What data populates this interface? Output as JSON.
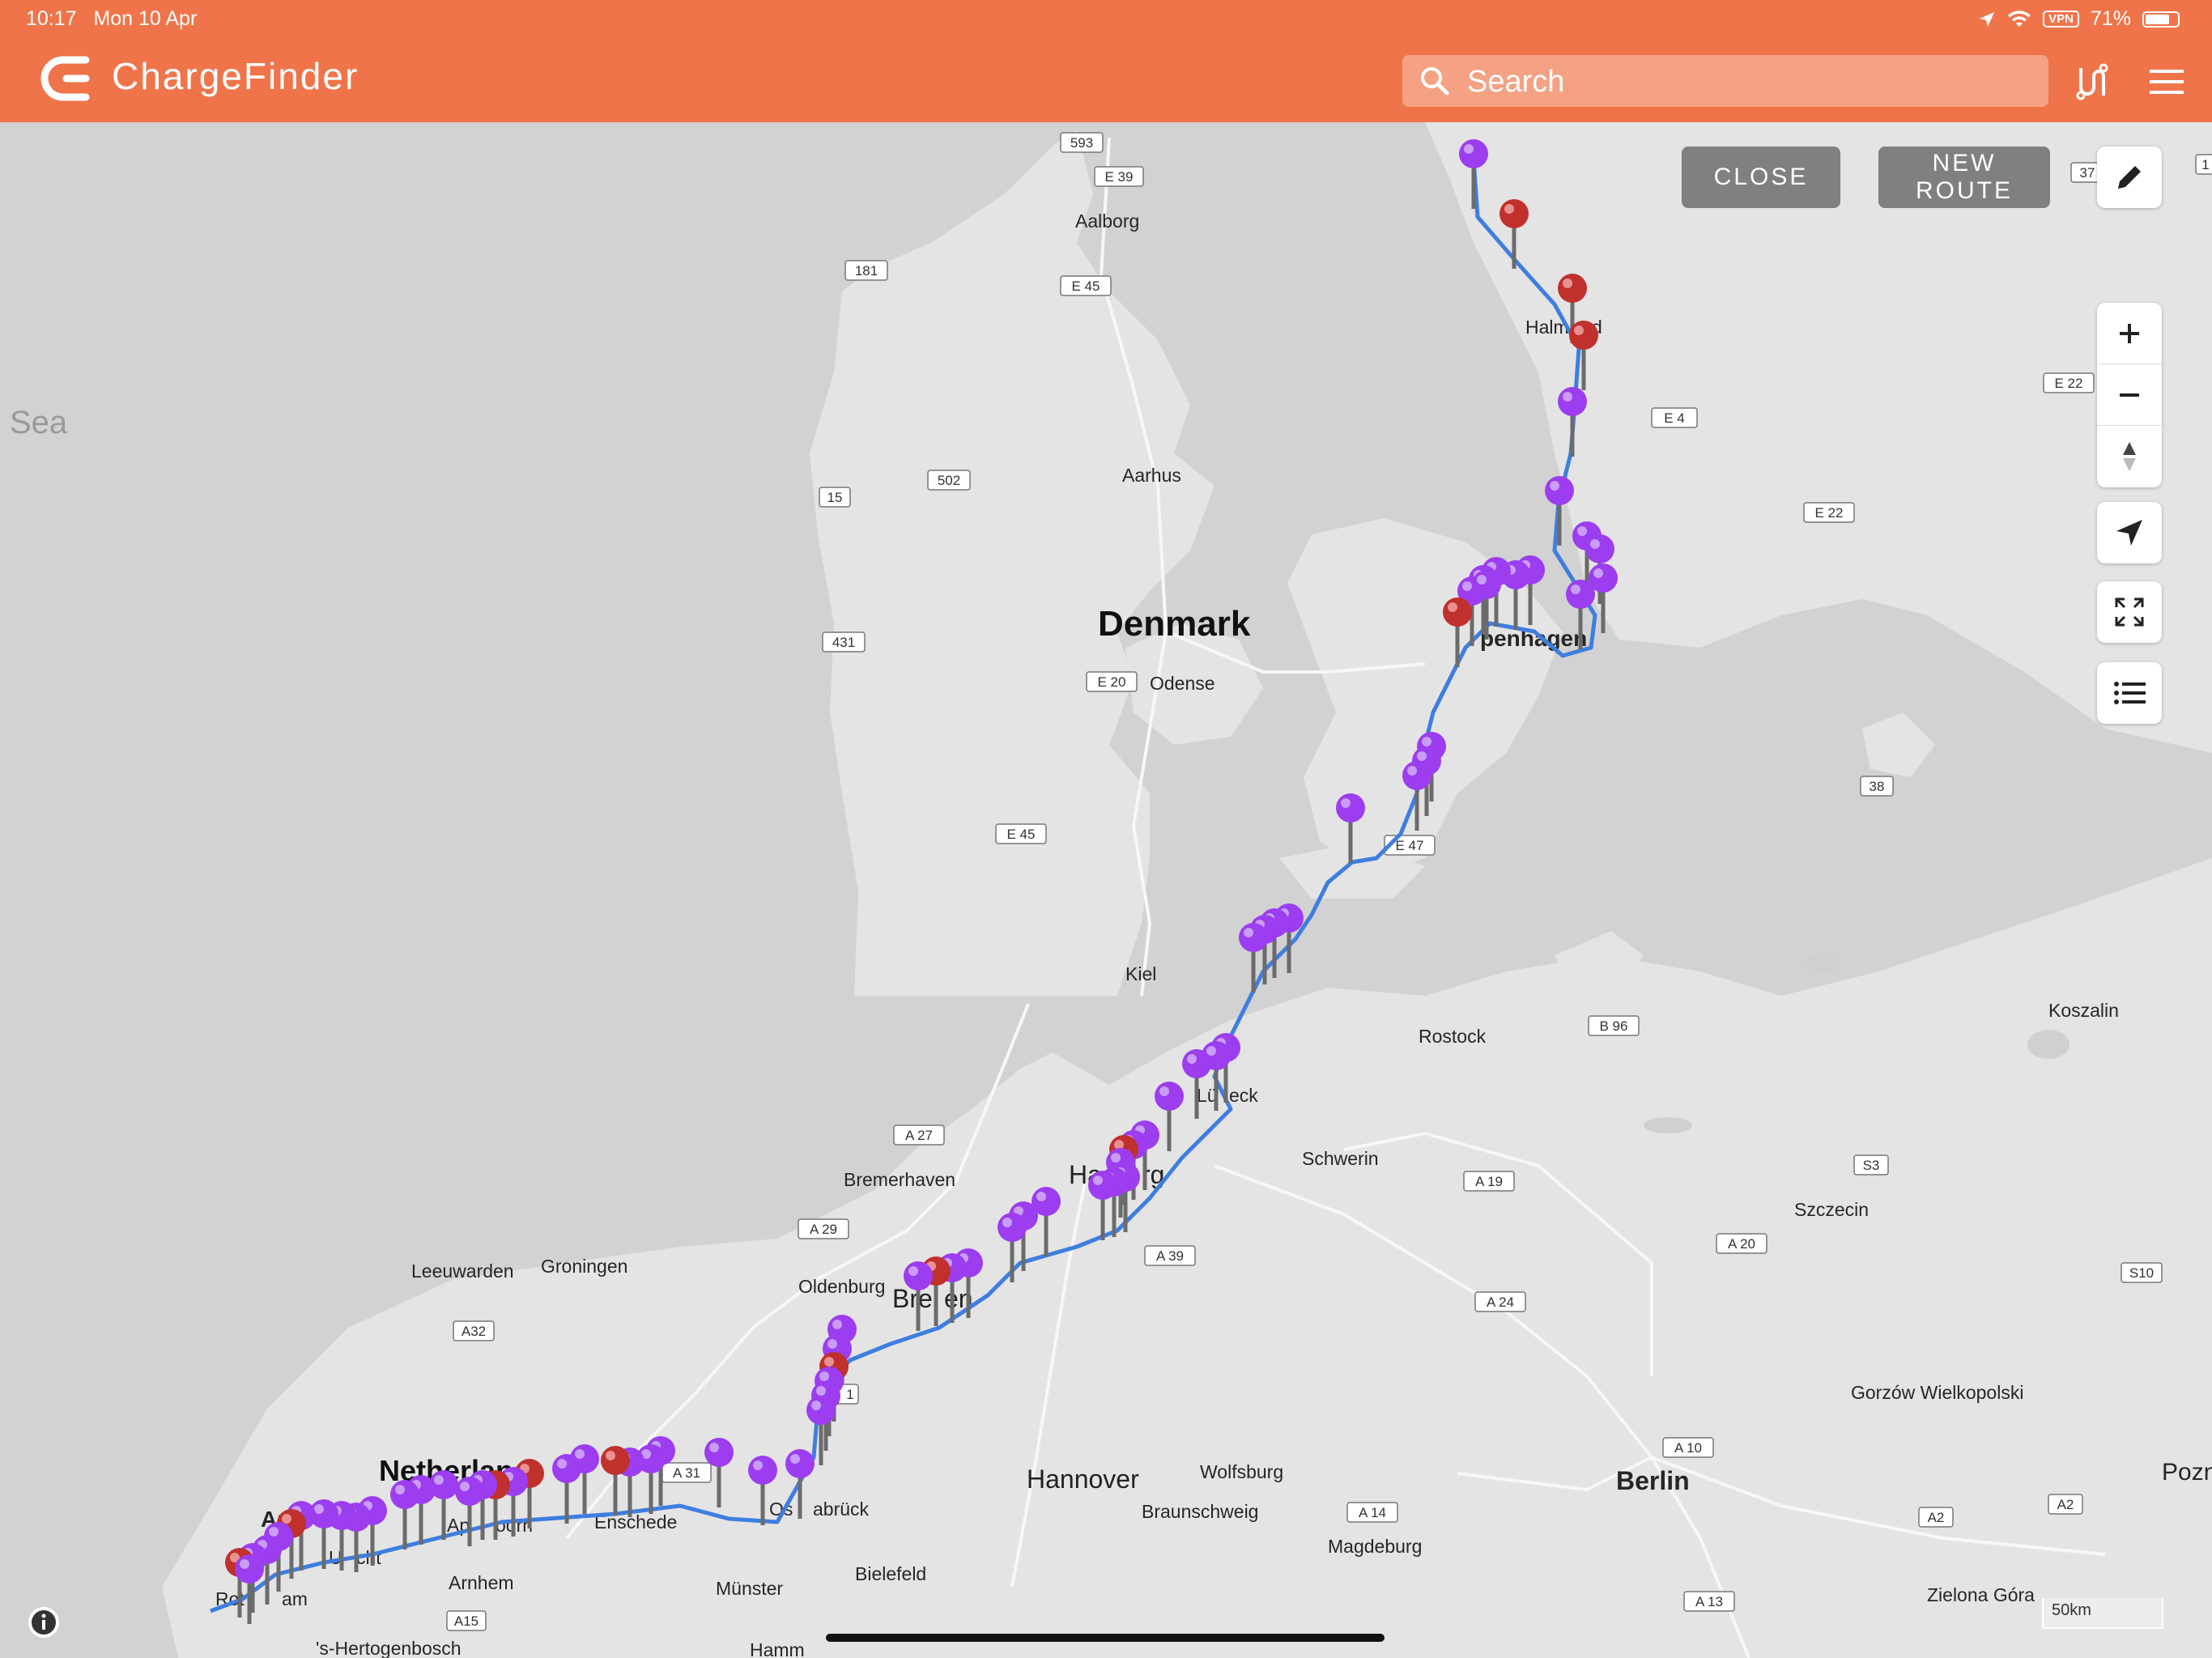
{
  "status_bar": {
    "time": "10:17",
    "date": "Mon 10 Apr",
    "vpn": "VPN",
    "battery": "71%"
  },
  "header": {
    "app_name": "ChargeFinder",
    "search_placeholder": "Search"
  },
  "route_controls": {
    "close_label": "CLOSE",
    "new_route_label": "NEW ROUTE"
  },
  "map": {
    "scale": "50km",
    "countries": {
      "denmark": "Denmark",
      "netherlands": "Netherland",
      "sea": "Sea"
    },
    "cities": {
      "aalborg": "Aalborg",
      "aarhus": "Aarhus",
      "odense": "Odense",
      "copenhagen": "penhagen",
      "halmstad": "Halm",
      "halmstad_end": "d",
      "kiel": "Kiel",
      "lubeck": "Lü",
      "lubeck_end": "eck",
      "rostock": "Rostock",
      "koszalin": "Koszalin",
      "schwerin": "Schwerin",
      "hamburg": "Ha",
      "hamburg_end": "rg",
      "bremerhaven": "Bremerhaven",
      "oldenburg": "Oldenburg",
      "bremen": "Bre",
      "bremen_end": "en",
      "szczecin": "Szczecin",
      "leeuwarden": "Leeuwarden",
      "groningen": "Groningen",
      "hannover": "Hannover",
      "wolfsburg": "Wolfsburg",
      "braunschweig": "Braunschweig",
      "berlin": "Berlin",
      "magdeburg": "Magdeburg",
      "gorzow": "Gorzów Wielkopolski",
      "poznan": "Pozn",
      "osnabruck_start": "Os",
      "osnabruck": "abrück",
      "enschede": "Enschede",
      "apeldoorn": "Ap",
      "apeldoorn_end": "oorn",
      "utrecht_start": "U",
      "utrecht": "cht",
      "amsterdam": "Am",
      "rotterdam": "Rot",
      "rotterdam_end": "am",
      "arnhem": "Arnhem",
      "munster": "Münster",
      "bielefeld": "Bielefeld",
      "zielona_gora": "Zielona Góra",
      "den_bosch": "'s-Hertogenbosch",
      "hamm": "Hamm"
    },
    "roads": {
      "r593": "593",
      "e39": "E 39",
      "r181": "181",
      "e45": "E 45",
      "r502": "502",
      "r15": "15",
      "r431": "431",
      "e20": "E 20",
      "e45b": "E 45",
      "e4": "E 4",
      "e4b": "E 4",
      "e22": "E 22",
      "e22b": "E 22",
      "r38": "38",
      "e47": "E 47",
      "r37": "37",
      "r1": "1",
      "b96": "B 96",
      "a27": "A 27",
      "a29": "A 29",
      "a39": "A 39",
      "a19": "A 19",
      "s3": "S3",
      "a20": "A 20",
      "a24": "A 24",
      "s10": "S10",
      "a32": "A32",
      "a31": "A 31",
      "a1": "1",
      "a10": "A 10",
      "a14": "A 14",
      "a2": "A2",
      "a2b": "A2",
      "a15": "A15",
      "a13": "A 13"
    },
    "route_color": "#3e7ee0",
    "pin_colors": {
      "available": "#9c3df0",
      "occupied": "#c0302d"
    }
  }
}
